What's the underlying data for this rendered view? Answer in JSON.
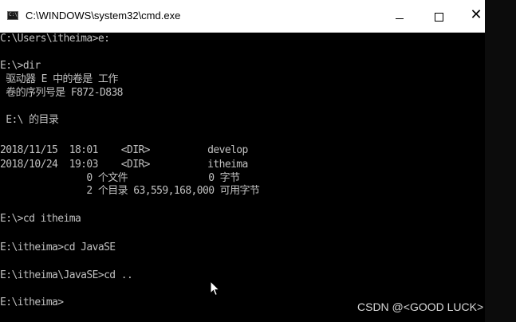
{
  "window": {
    "title": "C:\\WINDOWS\\system32\\cmd.exe",
    "icon": "cmd-console-icon",
    "icon_glyph": "C:\\",
    "buttons": {
      "minimize_icon": "minimize-icon",
      "maximize_icon": "maximize-icon",
      "close_icon": "close-icon",
      "close_glyph": "✕"
    }
  },
  "console": {
    "lines": [
      "C:\\Users\\itheima>e:",
      "",
      "E:\\>dir",
      " 驱动器 E 中的卷是 工作",
      " 卷的序列号是 F872-D838",
      "",
      " E:\\ 的目录",
      "",
      "2018/11/15  18:01    <DIR>          develop",
      "2018/10/24  19:03    <DIR>          itheima",
      "               0 个文件              0 字节",
      "               2 个目录 63,559,168,000 可用字节",
      "",
      "E:\\>cd itheima",
      "",
      "E:\\itheima>cd JavaSE",
      "",
      "E:\\itheima\\JavaSE>cd ..",
      "",
      "E:\\itheima>"
    ]
  },
  "overlay": {
    "cursor_icon": "mouse-pointer-icon",
    "watermark": "CSDN @<GOOD LUCK>"
  },
  "colors": {
    "console_background": "#000000",
    "console_text": "#c0c0c0",
    "titlebar_background": "#ffffff"
  }
}
